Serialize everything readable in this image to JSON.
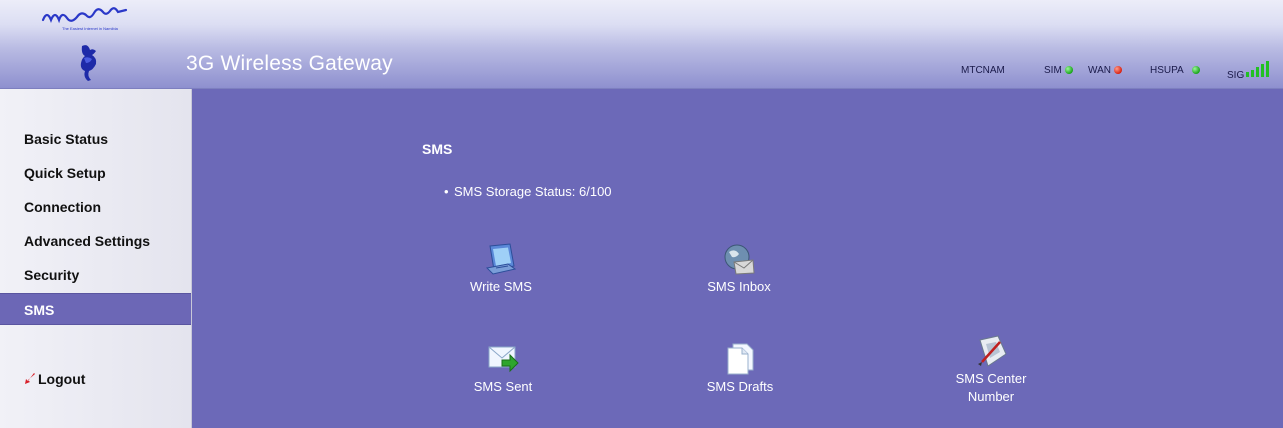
{
  "header": {
    "logo_text": "netman",
    "logo_tagline": "The Easiest Internet in Namibia",
    "product_title": "3G Wireless Gateway",
    "status": {
      "operator": "MTCNAM",
      "sim_label": "SIM",
      "sim_color": "#18a418",
      "wan_label": "WAN",
      "wan_color": "#d82010",
      "net_label": "HSUPA",
      "net_color": "#18a418",
      "sig_label": "SIG",
      "sig_color": "#22c022",
      "signal_bars": 5
    }
  },
  "sidebar": {
    "items": [
      {
        "label": "Basic Status"
      },
      {
        "label": "Quick Setup"
      },
      {
        "label": "Connection"
      },
      {
        "label": "Advanced Settings"
      },
      {
        "label": "Security"
      },
      {
        "label": "SMS",
        "active": true
      }
    ],
    "logout_label": "Logout"
  },
  "main": {
    "title": "SMS",
    "storage_status": "SMS Storage Status: 6/100",
    "tiles": [
      {
        "label": "Write SMS",
        "icon": "write-sms-icon"
      },
      {
        "label": "SMS Inbox",
        "icon": "inbox-icon"
      },
      {
        "label": "SMS Sent",
        "icon": "sent-mail-icon"
      },
      {
        "label": "SMS Drafts",
        "icon": "drafts-icon"
      },
      {
        "label": "SMS Center Number",
        "icon": "center-number-icon"
      }
    ]
  },
  "colors": {
    "content_background": "#6c69b8",
    "active_nav": "#6c67b6"
  }
}
